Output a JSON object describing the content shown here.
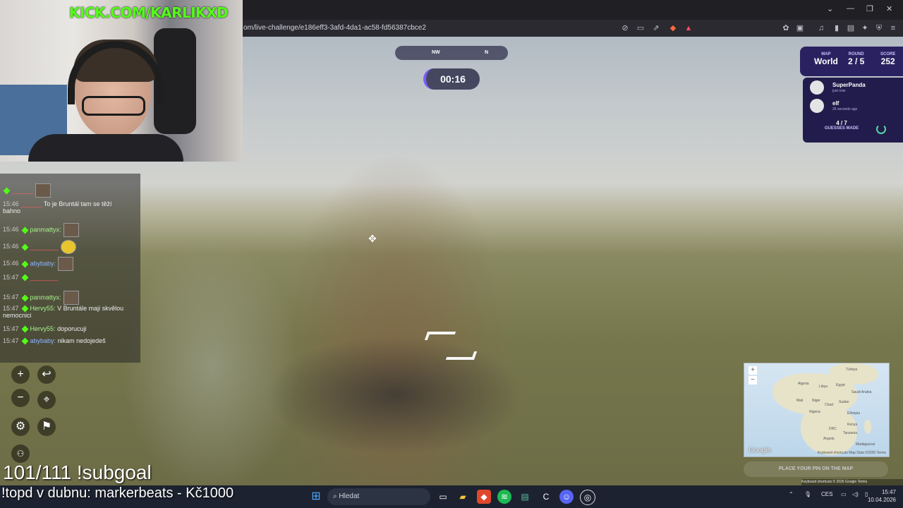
{
  "browser": {
    "url": "om/live-challenge/e186eff3-3afd-4da1-ac58-fd56387cbce2",
    "win_controls": [
      "⌄",
      "—",
      "❐",
      "✕"
    ]
  },
  "webcam": {
    "overlay_text": "KICK.COM/KARLIKXD"
  },
  "chat": {
    "messages": [
      {
        "time": "",
        "user": "",
        "text": "",
        "emote": true
      },
      {
        "time": "15:46",
        "user": "",
        "text": "To je Bruntál tam se těží bahno"
      },
      {
        "time": "15:46",
        "user": "panmattyx:",
        "text": "",
        "emote": true
      },
      {
        "time": "15:46",
        "user": "",
        "text": "",
        "emote": true
      },
      {
        "time": "15:46",
        "user": "abybaby:",
        "text": "",
        "emote": true
      },
      {
        "time": "15:47",
        "user": "",
        "text": ""
      },
      {
        "time": "15:47",
        "user": "panmattyx:",
        "text": "",
        "emote": true
      },
      {
        "time": "15:47",
        "user": "Hervy55:",
        "text": "V Bruntále maji skvělou nemocnici"
      },
      {
        "time": "15:47",
        "user": "Hervy55:",
        "text": "doporucuji"
      },
      {
        "time": "15:47",
        "user": "abybaby:",
        "text": "nikam nedojedeš"
      }
    ]
  },
  "game": {
    "compass": {
      "nw": "NW",
      "n": "N"
    },
    "timer": "00:16",
    "status": {
      "map_label": "MAP",
      "map_value": "World",
      "round_label": "ROUND",
      "round_value": "2 / 5",
      "score_label": "SCORE",
      "score_value": "252"
    },
    "players": [
      {
        "name": "SuperPanda",
        "sub": "just now"
      },
      {
        "name": "elf",
        "sub": "26 seconds ago"
      }
    ],
    "guesses_count": "4 / 7",
    "guesses_label": "GUESSES MADE",
    "minimap": {
      "labels": [
        "Türkiye",
        "Algeria",
        "Libya",
        "Egypt",
        "Saudi Arabia",
        "Mali",
        "Niger",
        "Chad",
        "Sudan",
        "Nigeria",
        "Ethiopia",
        "DRC",
        "Kenya",
        "Tanzania",
        "Angola",
        "Madagascar"
      ],
      "google": "Google",
      "attribution": "Keyboard shortcuts   Map Data ©2026   Terms"
    },
    "place_pin": "PLACE YOUR PIN ON THE MAP",
    "footer": "Keyboard shortcuts   © 2026 Google   Terms"
  },
  "overlay": {
    "subgoal": "101/111 !subgoal",
    "topd": "!topd v dubnu: markerbeats - Kč1000"
  },
  "taskbar": {
    "search_placeholder": "Hledat",
    "lang": "CES",
    "time": "15:47",
    "date": "10.04.2026"
  },
  "colors": {
    "kick_green": "#53fc18",
    "panel": "#2a2260"
  }
}
